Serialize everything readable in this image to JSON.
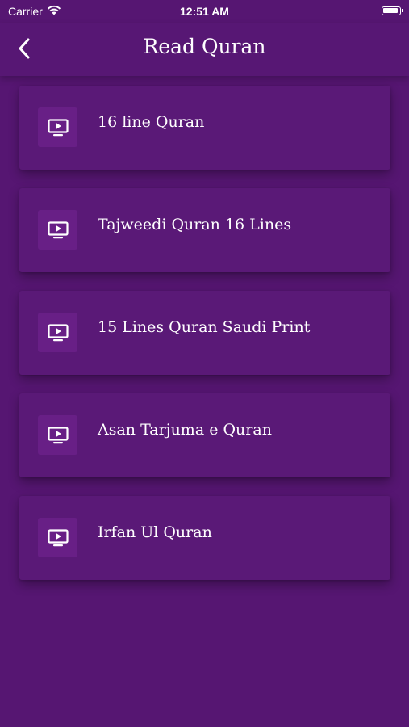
{
  "status_bar": {
    "carrier": "Carrier",
    "time": "12:51 AM",
    "wifi_icon": "wifi-icon",
    "battery_icon": "battery-icon"
  },
  "header": {
    "title": "Read Quran",
    "back_icon": "chevron-left-icon"
  },
  "items": [
    {
      "label": "16 line Quran",
      "icon": "tv-play-icon"
    },
    {
      "label": "Tajweedi Quran 16 Lines",
      "icon": "tv-play-icon"
    },
    {
      "label": "15 Lines Quran Saudi Print",
      "icon": "tv-play-icon"
    },
    {
      "label": "Asan Tarjuma e Quran",
      "icon": "tv-play-icon"
    },
    {
      "label": "Irfan Ul Quran",
      "icon": "tv-play-icon"
    }
  ],
  "colors": {
    "background": "#561672",
    "card": "#5a1977",
    "icon_box": "#681f86",
    "text": "#ffffff"
  }
}
